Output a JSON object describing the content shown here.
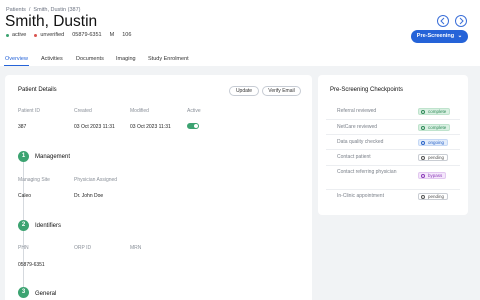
{
  "breadcrumb": {
    "root": "Patients",
    "separator": "/",
    "current": "Smith, Dustin (387)"
  },
  "patient": {
    "name": "Smith, Dustin",
    "status": "active",
    "verification": "unverified",
    "phn": "05879-6351",
    "sex": "M",
    "age": "106"
  },
  "actions": {
    "prev_icon": "chevron-left-icon",
    "next_icon": "chevron-right-icon",
    "workflow_label": "Pre-Screening",
    "workflow_chevron": "⌄"
  },
  "tabs": [
    "Overview",
    "Activities",
    "Documents",
    "Imaging",
    "Study Enrolment"
  ],
  "details": {
    "title": "Patient Details",
    "update_label": "Update",
    "verify_label": "Verify Email",
    "headers": {
      "id": "Patient ID",
      "created": "Created",
      "modified": "Modified",
      "active": "Active"
    },
    "values": {
      "id": "387",
      "created": "03 Oct 2023 11:31",
      "modified": "03 Oct 2023 11:31"
    }
  },
  "management": {
    "number": "1",
    "title": "Management",
    "headers": {
      "site": "Managing Site",
      "physician": "Physician Assigned"
    },
    "values": {
      "site": "Caleo",
      "physician": "Dr. John Doe"
    }
  },
  "identifiers": {
    "number": "2",
    "title": "Identifiers",
    "headers": {
      "phn": "PHN",
      "orp": "ORP ID",
      "mrn": "MRN"
    },
    "values": {
      "phn": "05879-6351"
    }
  },
  "general": {
    "number": "3",
    "title": "General"
  },
  "checkpoints": {
    "title": "Pre-Screening Checkpoints",
    "items": [
      {
        "label": "Referral reviewed",
        "status": "complete"
      },
      {
        "label": "NetCare reviewed",
        "status": "complete"
      },
      {
        "label": "Data quality checked",
        "status": "ongoing"
      },
      {
        "label": "Contact patient",
        "status": "pending"
      },
      {
        "label": "Contact referring physician",
        "status": "bypass"
      },
      {
        "label": "In-Clinic appointment",
        "status": "pending"
      }
    ]
  },
  "colors": {
    "accent": "#2563d8",
    "success": "#3ca371",
    "active_dot": "#3ca371",
    "unverified_dot": "#d9534f"
  }
}
